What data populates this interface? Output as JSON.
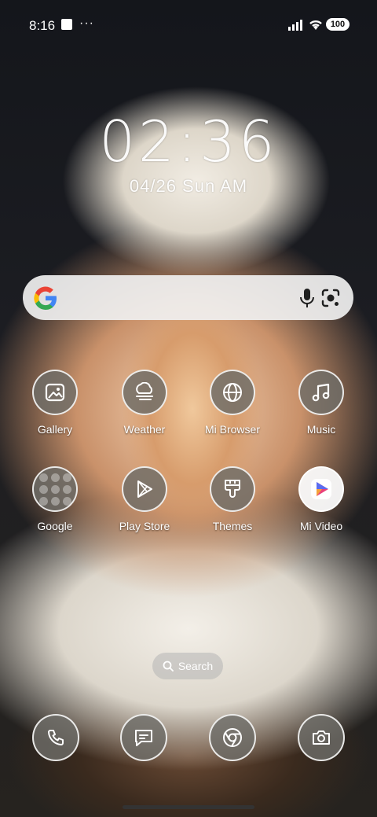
{
  "status_bar": {
    "time": "8:16",
    "more_indicator": "···",
    "battery": "100"
  },
  "clock": {
    "time": "02:36",
    "date": "04/26 Sun AM"
  },
  "search_widget": {
    "icons": [
      "google-g-icon",
      "microphone-icon",
      "lens-icon"
    ]
  },
  "apps": [
    {
      "label": "Gallery",
      "icon": "gallery-icon"
    },
    {
      "label": "Weather",
      "icon": "weather-icon"
    },
    {
      "label": "Mi Browser",
      "icon": "globe-icon"
    },
    {
      "label": "Music",
      "icon": "music-note-icon"
    },
    {
      "label": "Google",
      "icon": "folder-icon"
    },
    {
      "label": "Play Store",
      "icon": "play-store-icon"
    },
    {
      "label": "Themes",
      "icon": "paint-brush-icon"
    },
    {
      "label": "Mi Video",
      "icon": "mi-video-icon"
    }
  ],
  "app_search": {
    "label": "Search"
  },
  "dock": [
    {
      "icon": "phone-icon"
    },
    {
      "icon": "messages-icon"
    },
    {
      "icon": "chrome-icon"
    },
    {
      "icon": "camera-icon"
    }
  ]
}
